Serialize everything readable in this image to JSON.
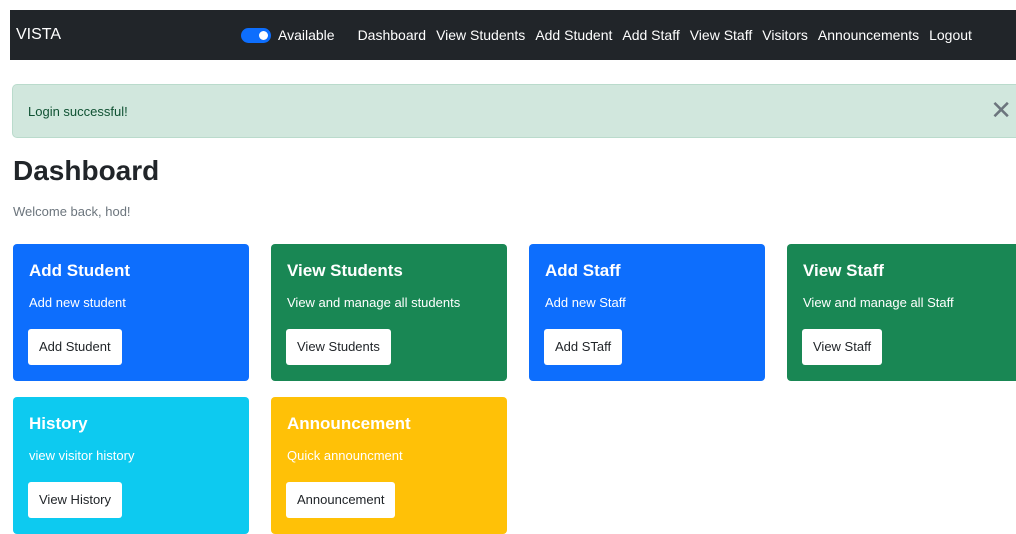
{
  "navbar": {
    "brand": "VISTA",
    "availability_label": "Available",
    "links": [
      "Dashboard",
      "View Students",
      "Add Student",
      "Add Staff",
      "View Staff",
      "Visitors",
      "Announcements",
      "Logout"
    ]
  },
  "alert": {
    "message": "Login successful!",
    "close_icon": "close-icon"
  },
  "page": {
    "title": "Dashboard",
    "welcome": "Welcome back, hod!"
  },
  "cards": [
    {
      "title": "Add Student",
      "text": "Add new student",
      "button": "Add Student",
      "color": "#0d6efd"
    },
    {
      "title": "View Students",
      "text": "View and manage all students",
      "button": "View Students",
      "color": "#198754"
    },
    {
      "title": "Add Staff",
      "text": "Add new Staff",
      "button": "Add STaff",
      "color": "#0d6efd"
    },
    {
      "title": "View Staff",
      "text": "View and manage all Staff",
      "button": "View Staff",
      "color": "#198754"
    },
    {
      "title": "History",
      "text": "view visitor history",
      "button": "View History",
      "color": "#0dcaf0"
    },
    {
      "title": "Announcement",
      "text": "Quick announcment",
      "button": "Announcement",
      "color": "#ffc107"
    }
  ]
}
